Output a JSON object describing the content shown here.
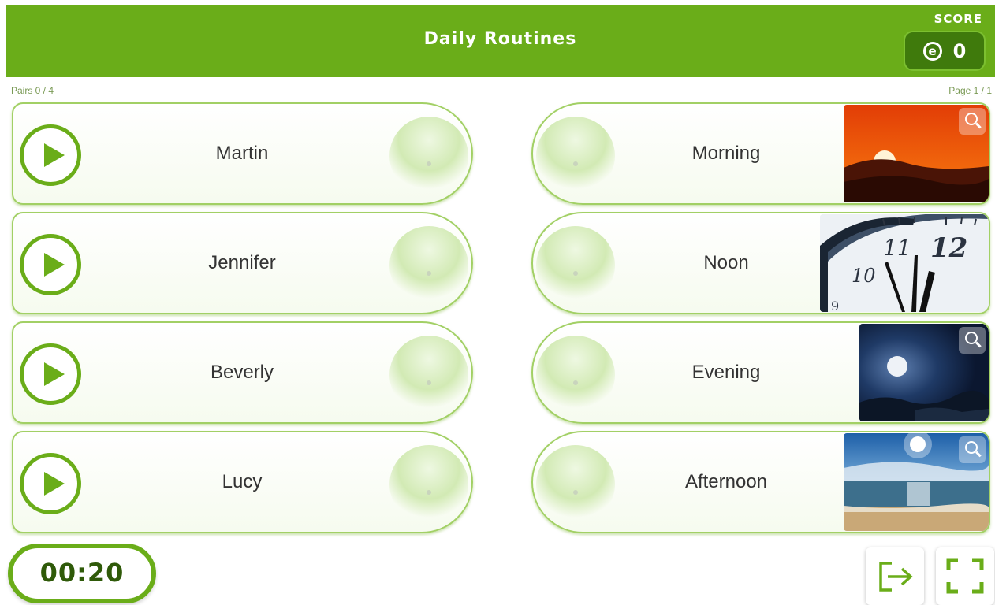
{
  "header": {
    "title": "Daily Routines",
    "score_label": "SCORE",
    "score_value": "0",
    "coin_glyph": "e"
  },
  "meta": {
    "pairs": "Pairs 0 / 4",
    "page": "Page 1 / 1"
  },
  "left_cards": [
    {
      "label": "Martin"
    },
    {
      "label": "Jennifer"
    },
    {
      "label": "Beverly"
    },
    {
      "label": "Lucy"
    }
  ],
  "right_cards": [
    {
      "label": "Morning",
      "image": "sunset-photo"
    },
    {
      "label": "Noon",
      "image": "clock-photo"
    },
    {
      "label": "Evening",
      "image": "moon-night-photo"
    },
    {
      "label": "Afternoon",
      "image": "beach-sun-photo"
    }
  ],
  "footer": {
    "timer": "00:20",
    "exit_icon": "exit-icon",
    "fullscreen_icon": "fullscreen-icon"
  },
  "colors": {
    "accent": "#6aad19",
    "accent_dark": "#3f7a0c",
    "card_border": "#a2d065"
  }
}
